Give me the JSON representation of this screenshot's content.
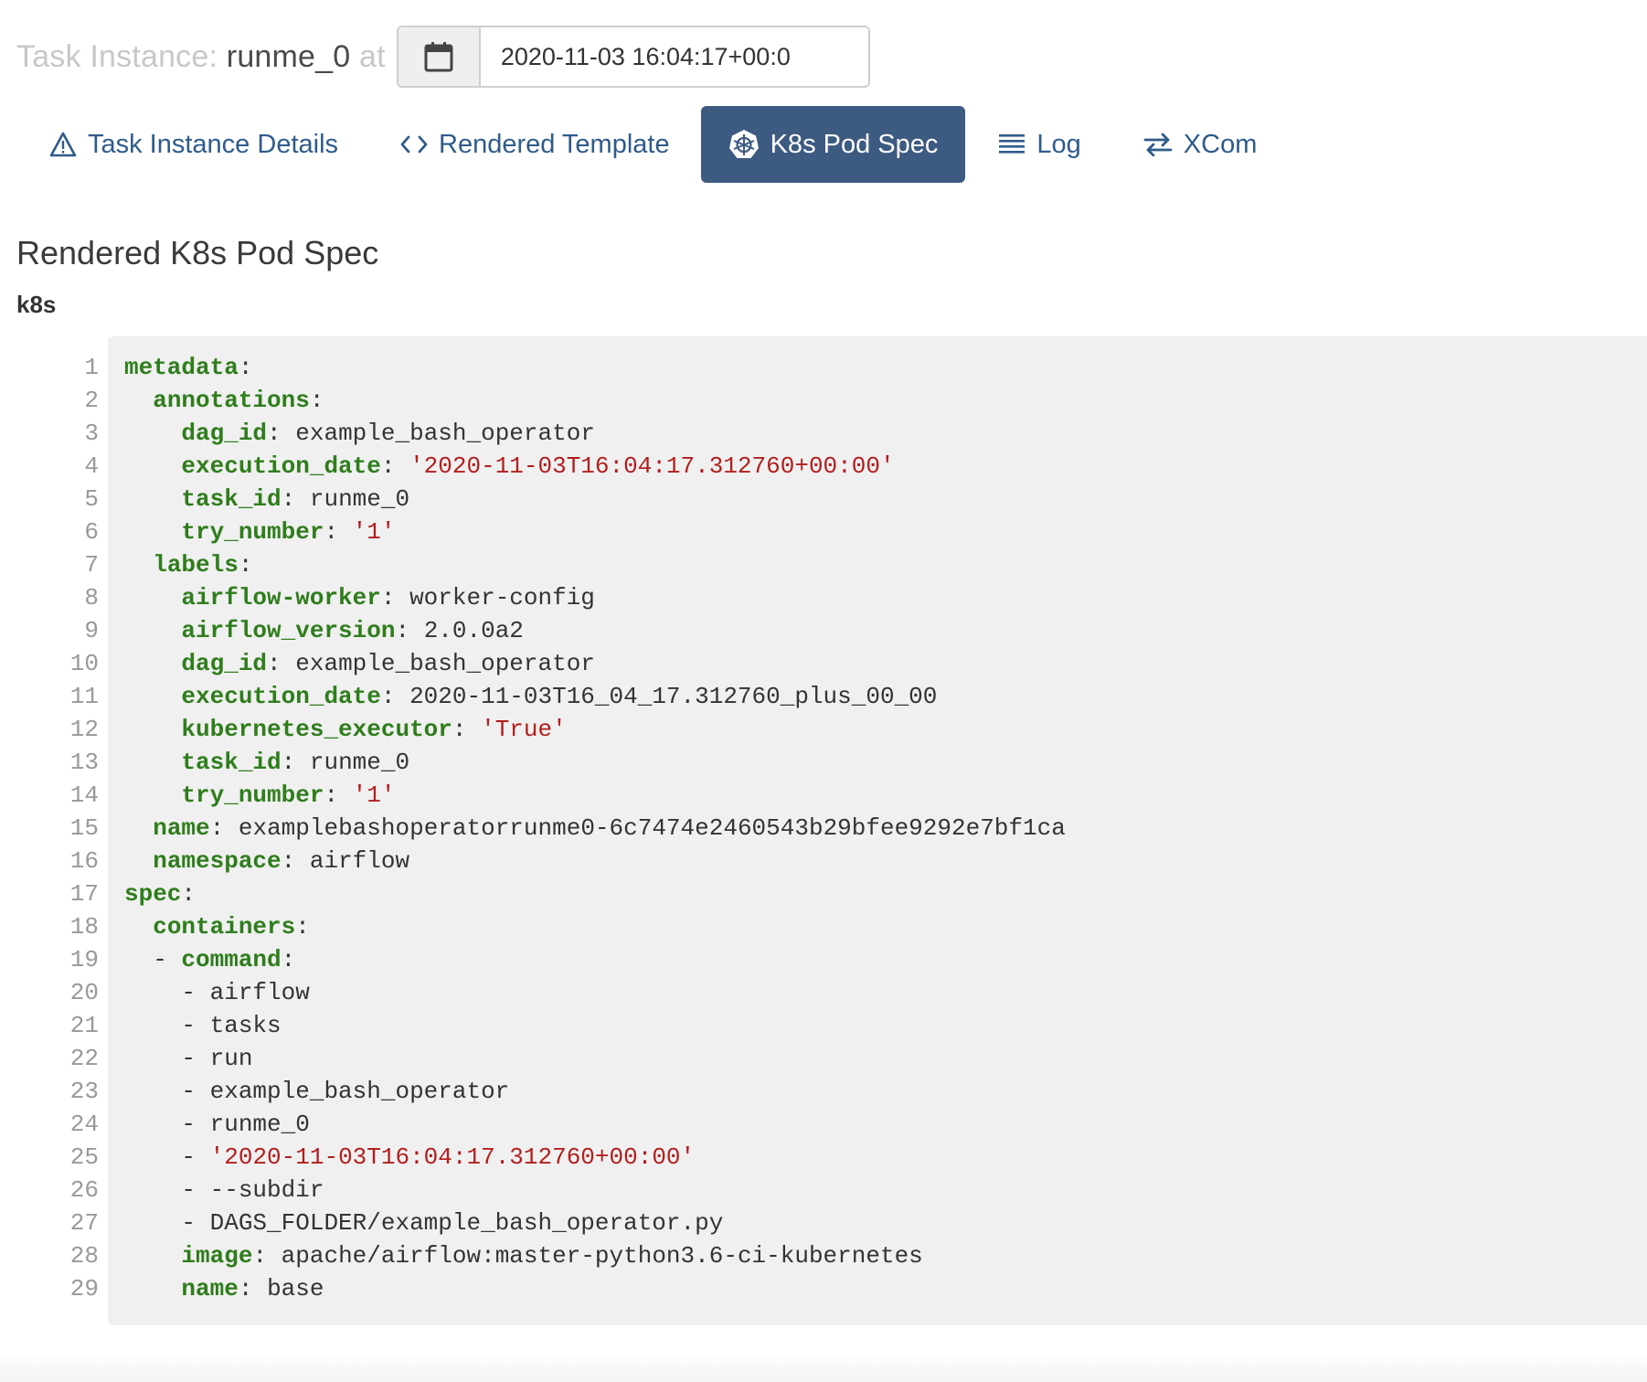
{
  "header": {
    "label": "Task Instance:",
    "task_name": "runme_0",
    "at_label": "at",
    "date_value": "2020-11-03 16:04:17+00:0"
  },
  "tabs": [
    {
      "label": "Task Instance Details",
      "icon": "warning-triangle-icon",
      "active": false
    },
    {
      "label": "Rendered Template",
      "icon": "code-icon",
      "active": false
    },
    {
      "label": "K8s Pod Spec",
      "icon": "kubernetes-helm-icon",
      "active": true
    },
    {
      "label": "Log",
      "icon": "list-lines-icon",
      "active": false
    },
    {
      "label": "XCom",
      "icon": "swap-arrows-icon",
      "active": false
    }
  ],
  "section": {
    "title": "Rendered K8s Pod Spec",
    "subtitle": "k8s"
  },
  "colors": {
    "active_tab_bg": "#3d5a80",
    "tab_text": "#2f5b8a",
    "yaml_key": "#2f7d1c",
    "yaml_string": "#b21e1e",
    "code_bg": "#f0f0f0"
  },
  "code_lines": [
    {
      "indent": "",
      "key": "metadata",
      "sep": ":",
      "val": "",
      "str": ""
    },
    {
      "indent": "  ",
      "key": "annotations",
      "sep": ":",
      "val": "",
      "str": ""
    },
    {
      "indent": "    ",
      "key": "dag_id",
      "sep": ": ",
      "val": "example_bash_operator",
      "str": ""
    },
    {
      "indent": "    ",
      "key": "execution_date",
      "sep": ": ",
      "val": "",
      "str": "'2020-11-03T16:04:17.312760+00:00'"
    },
    {
      "indent": "    ",
      "key": "task_id",
      "sep": ": ",
      "val": "runme_0",
      "str": ""
    },
    {
      "indent": "    ",
      "key": "try_number",
      "sep": ": ",
      "val": "",
      "str": "'1'"
    },
    {
      "indent": "  ",
      "key": "labels",
      "sep": ":",
      "val": "",
      "str": ""
    },
    {
      "indent": "    ",
      "key": "airflow-worker",
      "sep": ": ",
      "val": "worker-config",
      "str": ""
    },
    {
      "indent": "    ",
      "key": "airflow_version",
      "sep": ": ",
      "val": "2.0.0a2",
      "str": ""
    },
    {
      "indent": "    ",
      "key": "dag_id",
      "sep": ": ",
      "val": "example_bash_operator",
      "str": ""
    },
    {
      "indent": "    ",
      "key": "execution_date",
      "sep": ": ",
      "val": "2020-11-03T16_04_17.312760_plus_00_00",
      "str": ""
    },
    {
      "indent": "    ",
      "key": "kubernetes_executor",
      "sep": ": ",
      "val": "",
      "str": "'True'"
    },
    {
      "indent": "    ",
      "key": "task_id",
      "sep": ": ",
      "val": "runme_0",
      "str": ""
    },
    {
      "indent": "    ",
      "key": "try_number",
      "sep": ": ",
      "val": "",
      "str": "'1'"
    },
    {
      "indent": "  ",
      "key": "name",
      "sep": ": ",
      "val": "examplebashoperatorrunme0-6c7474e2460543b29bfee9292e7bf1ca",
      "str": ""
    },
    {
      "indent": "  ",
      "key": "namespace",
      "sep": ": ",
      "val": "airflow",
      "str": ""
    },
    {
      "indent": "",
      "key": "spec",
      "sep": ":",
      "val": "",
      "str": ""
    },
    {
      "indent": "  ",
      "key": "containers",
      "sep": ":",
      "val": "",
      "str": ""
    },
    {
      "indent": "  - ",
      "key": "command",
      "sep": ":",
      "val": "",
      "str": ""
    },
    {
      "indent": "    ",
      "key": "",
      "sep": "",
      "val": "- airflow",
      "str": ""
    },
    {
      "indent": "    ",
      "key": "",
      "sep": "",
      "val": "- tasks",
      "str": ""
    },
    {
      "indent": "    ",
      "key": "",
      "sep": "",
      "val": "- run",
      "str": ""
    },
    {
      "indent": "    ",
      "key": "",
      "sep": "",
      "val": "- example_bash_operator",
      "str": ""
    },
    {
      "indent": "    ",
      "key": "",
      "sep": "",
      "val": "- runme_0",
      "str": ""
    },
    {
      "indent": "    ",
      "key": "",
      "sep": "",
      "val": "- ",
      "str": "'2020-11-03T16:04:17.312760+00:00'"
    },
    {
      "indent": "    ",
      "key": "",
      "sep": "",
      "val": "- --subdir",
      "str": ""
    },
    {
      "indent": "    ",
      "key": "",
      "sep": "",
      "val": "- DAGS_FOLDER/example_bash_operator.py",
      "str": ""
    },
    {
      "indent": "    ",
      "key": "image",
      "sep": ": ",
      "val": "apache/airflow:master-python3.6-ci-kubernetes",
      "str": ""
    },
    {
      "indent": "    ",
      "key": "name",
      "sep": ": ",
      "val": "base",
      "str": ""
    }
  ]
}
